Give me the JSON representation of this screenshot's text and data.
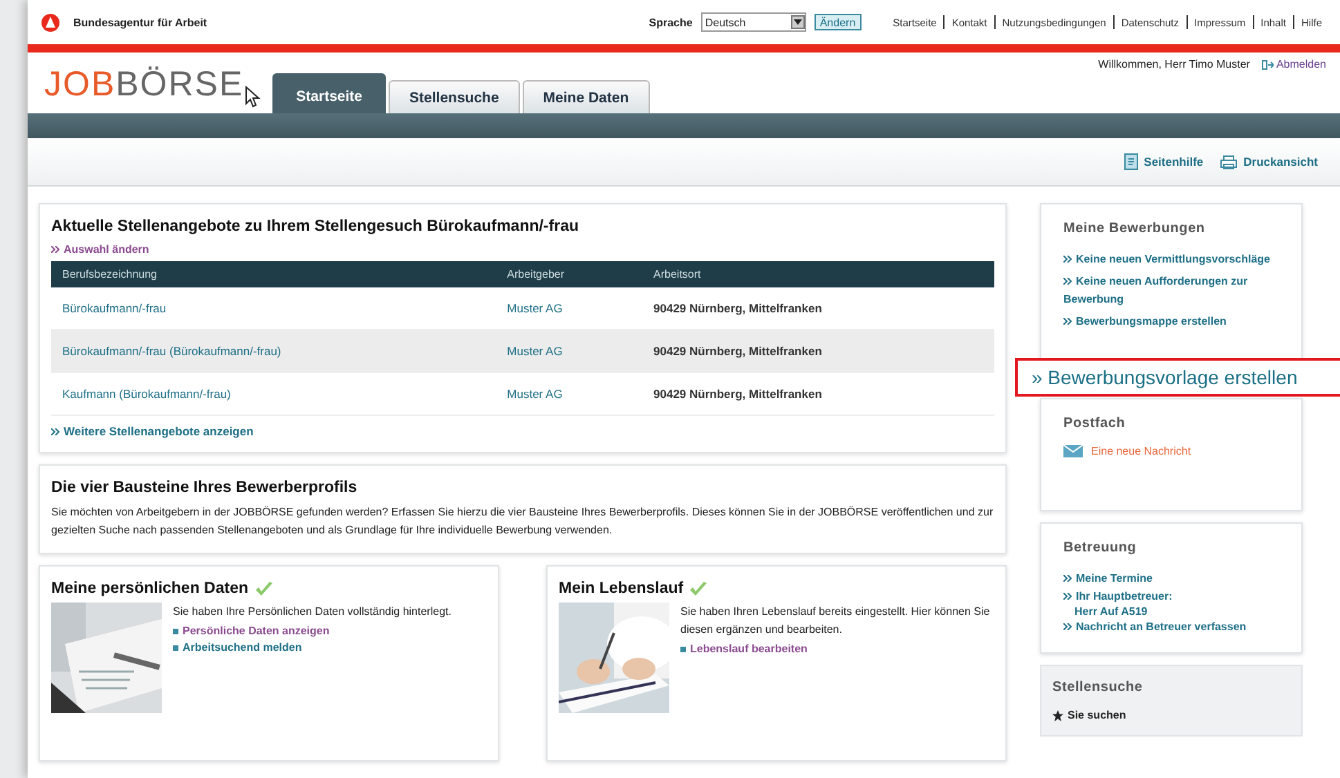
{
  "header": {
    "org": "Bundesagentur für Arbeit",
    "language_label": "Sprache",
    "language": "Deutsch",
    "change_button": "Ändern",
    "nav": [
      "Startseite",
      "Kontakt",
      "Nutzungsbedingungen",
      "Datenschutz",
      "Impressum",
      "Inhalt",
      "Hilfe"
    ]
  },
  "brand": {
    "accent": "JOB",
    "rest": "BÖRSE"
  },
  "tabs": [
    {
      "label": "Startseite",
      "selected": true
    },
    {
      "label": "Stellensuche",
      "selected": false
    },
    {
      "label": "Meine Daten",
      "selected": false
    }
  ],
  "user": {
    "welcome": "Willkommen, Herr Timo Muster",
    "logout": "Abmelden"
  },
  "tools": [
    {
      "kind": "help",
      "label": "Seitenhilfe"
    },
    {
      "kind": "print",
      "label": "Druckansicht"
    }
  ],
  "offers": {
    "title": "Aktuelle Stellenangebote zu Ihrem Stellengesuch Bürokaufmann/-frau",
    "change_link": "Auswahl ändern",
    "columns": [
      "Berufsbezeichnung",
      "Arbeitgeber",
      "Arbeitsort"
    ],
    "rows": [
      [
        "Bürokaufmann/-frau",
        "Muster AG",
        "90429 Nürnberg, Mittelfranken"
      ],
      [
        "Bürokaufmann/-frau (Bürokaufmann/-frau)",
        "Muster AG",
        "90429 Nürnberg, Mittelfranken"
      ],
      [
        "Kaufmann (Bürokaufmann/-frau)",
        "Muster AG",
        "90429 Nürnberg, Mittelfranken"
      ]
    ],
    "more_link": "Weitere Stellenangebote anzeigen"
  },
  "profile": {
    "title": "Die vier Bausteine Ihres Bewerberprofils",
    "text": "Sie möchten von Arbeitgebern in der JOBBÖRSE gefunden werden? Erfassen Sie hierzu die vier Bausteine Ihres Bewerberprofils. Dieses können Sie in der JOBBÖRSE veröffentlichen und zur gezielten Suche nach passenden Stellenangeboten und als Grundlage für Ihre individuelle Bewerbung verwenden.",
    "cards": [
      {
        "title": "Meine persönlichen Daten",
        "done": true,
        "text": "Sie haben Ihre Persönlichen Daten vollständig hinterlegt.",
        "links": [
          {
            "label": "Persönliche Daten anzeigen",
            "visited": true
          },
          {
            "label": "Arbeitsuchend melden",
            "visited": false
          }
        ]
      },
      {
        "title": "Mein Lebenslauf",
        "done": true,
        "text": "Sie haben Ihren Lebenslauf bereits eingestellt. Hier können Sie diesen ergänzen und bearbeiten.",
        "links": [
          {
            "label": "Lebenslauf bearbeiten",
            "visited": true
          }
        ]
      }
    ]
  },
  "sidebar": {
    "applications": {
      "title": "Meine Bewerbungen",
      "items": [
        "Keine neuen Vermittlungsvorschläge",
        "Keine neuen Aufforderungen zur Bewerbung",
        "Bewerbungsmappe erstellen"
      ]
    },
    "callout": "» Bewerbungsvorlage erstellen",
    "mailbox": {
      "title": "Postfach",
      "message": "Eine neue Nachricht"
    },
    "support": {
      "title": "Betreuung",
      "items": [
        {
          "label": "Meine Termine"
        },
        {
          "label": "Ihr Hauptbetreuer:",
          "detail": "Herr Auf A519"
        },
        {
          "label": "Nachricht an Betreuer verfassen"
        }
      ]
    },
    "search": {
      "title": "Stellensuche",
      "items": [
        "Sie suchen"
      ]
    }
  }
}
